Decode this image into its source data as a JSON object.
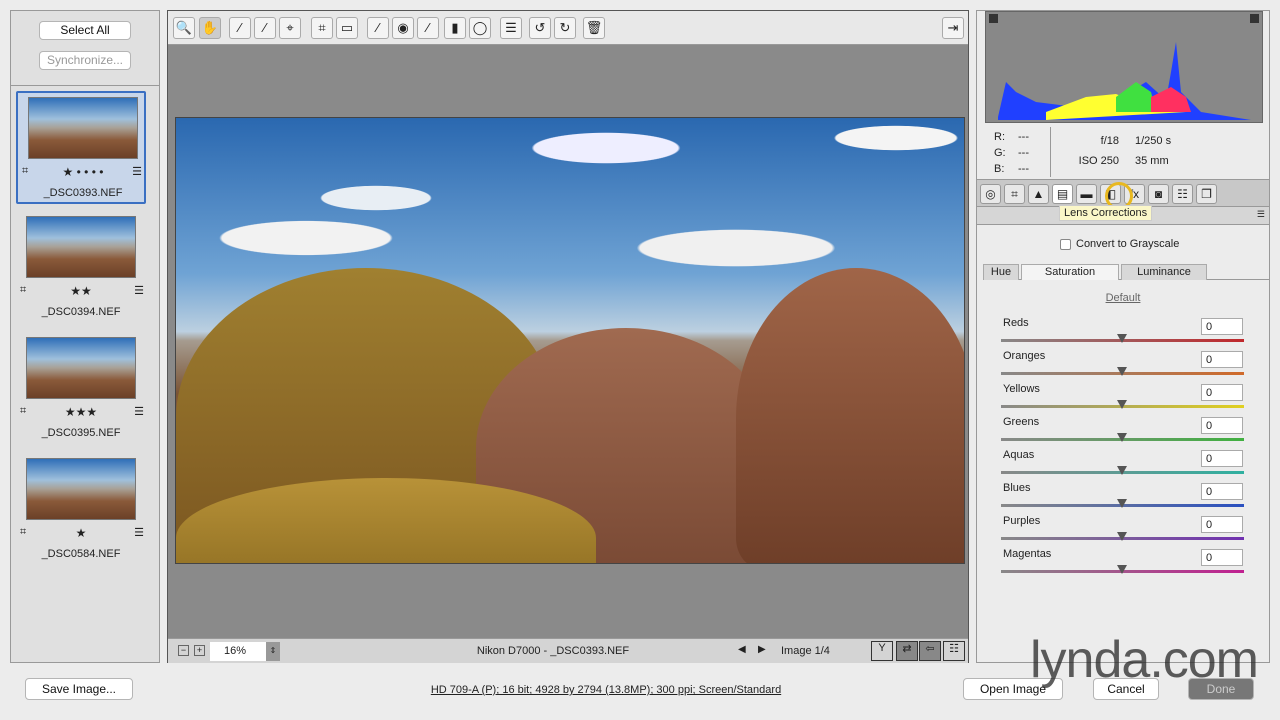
{
  "filmstrip": {
    "select_all": "Select All",
    "synchronize": "Synchronize...",
    "items": [
      {
        "name": "_DSC0393.NEF",
        "stars": "★ • • • •"
      },
      {
        "name": "_DSC0394.NEF",
        "stars": "★★"
      },
      {
        "name": "_DSC0395.NEF",
        "stars": "★★★"
      },
      {
        "name": "_DSC0584.NEF",
        "stars": "★"
      }
    ]
  },
  "toolbar": {
    "tools": [
      "🔍",
      "✋",
      "⁄",
      "⁄",
      "⌖",
      "⌗",
      "▭",
      "⁄",
      "◉",
      "⁄",
      "▮",
      "◯",
      "☰",
      "↺",
      "↻",
      "🗑"
    ],
    "open_prefs": "⇥"
  },
  "bottom_bar": {
    "zoom": "16%",
    "caption": "Nikon D7000  -  _DSC0393.NEF",
    "image_counter": "Image 1/4"
  },
  "info": {
    "r_label": "R:",
    "g_label": "G:",
    "b_label": "B:",
    "r": "---",
    "g": "---",
    "b": "---",
    "aperture": "f/18",
    "shutter": "1/250 s",
    "iso": "ISO 250",
    "focal": "35 mm"
  },
  "panel_tabs": [
    "◎",
    "⌗",
    "▲",
    "▤",
    "▬",
    "◧",
    "fx",
    "◙",
    "☷",
    "❐"
  ],
  "tooltip": "Lens Corrections",
  "hsl": {
    "grayscale_label": "Convert to Grayscale",
    "tabs": [
      "Hue",
      "Saturation",
      "Luminance"
    ],
    "default_link": "Default",
    "sliders": [
      {
        "label": "Reds",
        "value": "0",
        "color": "#c0282c"
      },
      {
        "label": "Oranges",
        "value": "0",
        "color": "#d06a2a"
      },
      {
        "label": "Yellows",
        "value": "0",
        "color": "#e0d020"
      },
      {
        "label": "Greens",
        "value": "0",
        "color": "#40b040"
      },
      {
        "label": "Aquas",
        "value": "0",
        "color": "#30b0a0"
      },
      {
        "label": "Blues",
        "value": "0",
        "color": "#2a50c0"
      },
      {
        "label": "Purples",
        "value": "0",
        "color": "#7030b0"
      },
      {
        "label": "Magentas",
        "value": "0",
        "color": "#c02090"
      }
    ]
  },
  "footer": {
    "save": "Save Image...",
    "workflow": "HD 709-A (P); 16 bit; 4928 by 2794 (13.8MP); 300 ppi; Screen/Standard",
    "open": "Open Image",
    "cancel": "Cancel",
    "done": "Done",
    "watermark": "lynda.com"
  }
}
